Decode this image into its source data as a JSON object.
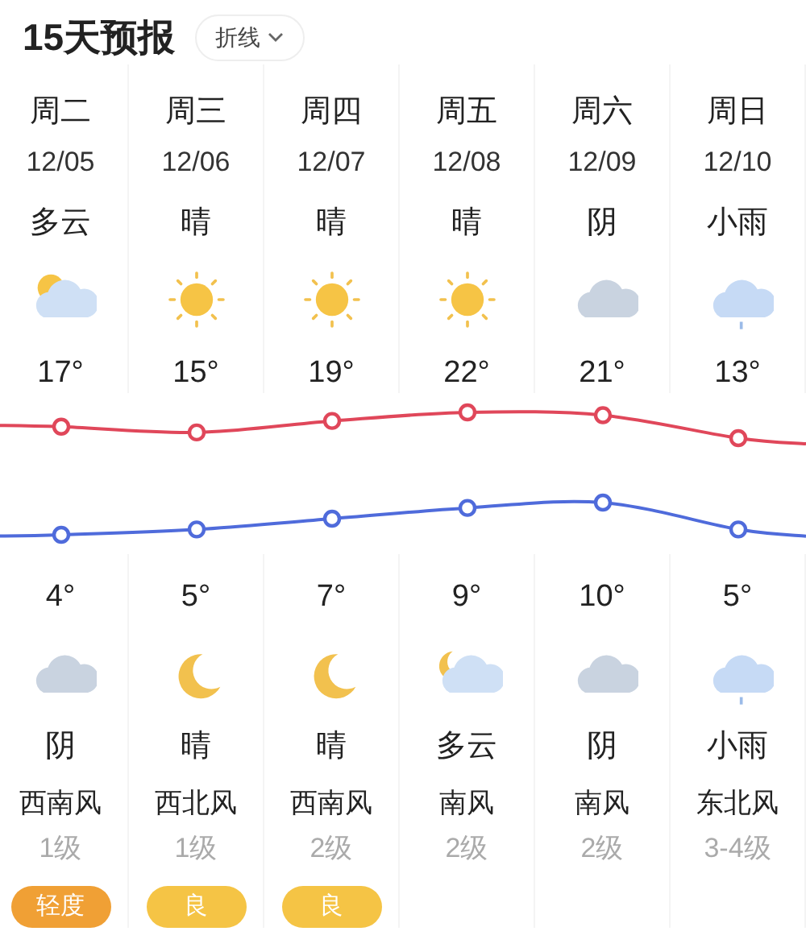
{
  "header": {
    "title": "15天预报",
    "view_dropdown": {
      "label": "折线"
    }
  },
  "days": [
    {
      "weekday": "周二",
      "date": "12/05",
      "day_condition": "多云",
      "day_icon": {
        "kind": "partly_cloudy"
      },
      "high": "17°",
      "low": "4°",
      "night_icon": {
        "kind": "cloudy"
      },
      "night_condition": "阴",
      "wind": "西南风",
      "wind_level": "1级",
      "aqi": {
        "label": "轻度",
        "color": "#f0a035"
      }
    },
    {
      "weekday": "周三",
      "date": "12/06",
      "day_condition": "晴",
      "day_icon": {
        "kind": "sunny"
      },
      "high": "15°",
      "low": "5°",
      "night_icon": {
        "kind": "moon"
      },
      "night_condition": "晴",
      "wind": "西北风",
      "wind_level": "1级",
      "aqi": {
        "label": "良",
        "color": "#f5c445"
      }
    },
    {
      "weekday": "周四",
      "date": "12/07",
      "day_condition": "晴",
      "day_icon": {
        "kind": "sunny"
      },
      "high": "19°",
      "low": "7°",
      "night_icon": {
        "kind": "moon"
      },
      "night_condition": "晴",
      "wind": "西南风",
      "wind_level": "2级",
      "aqi": {
        "label": "良",
        "color": "#f5c445"
      }
    },
    {
      "weekday": "周五",
      "date": "12/08",
      "day_condition": "晴",
      "day_icon": {
        "kind": "sunny"
      },
      "high": "22°",
      "low": "9°",
      "night_icon": {
        "kind": "moon_cloud"
      },
      "night_condition": "多云",
      "wind": "南风",
      "wind_level": "2级"
    },
    {
      "weekday": "周六",
      "date": "12/09",
      "day_condition": "阴",
      "day_icon": {
        "kind": "cloudy"
      },
      "high": "21°",
      "low": "10°",
      "night_icon": {
        "kind": "cloudy"
      },
      "night_condition": "阴",
      "wind": "南风",
      "wind_level": "2级"
    },
    {
      "weekday": "周日",
      "date": "12/10",
      "day_condition": "小雨",
      "day_icon": {
        "kind": "rain"
      },
      "high": "13°",
      "low": "5°",
      "night_icon": {
        "kind": "rain"
      },
      "night_condition": "小雨",
      "wind": "东北风",
      "wind_level": "3-4级"
    }
  ]
}
